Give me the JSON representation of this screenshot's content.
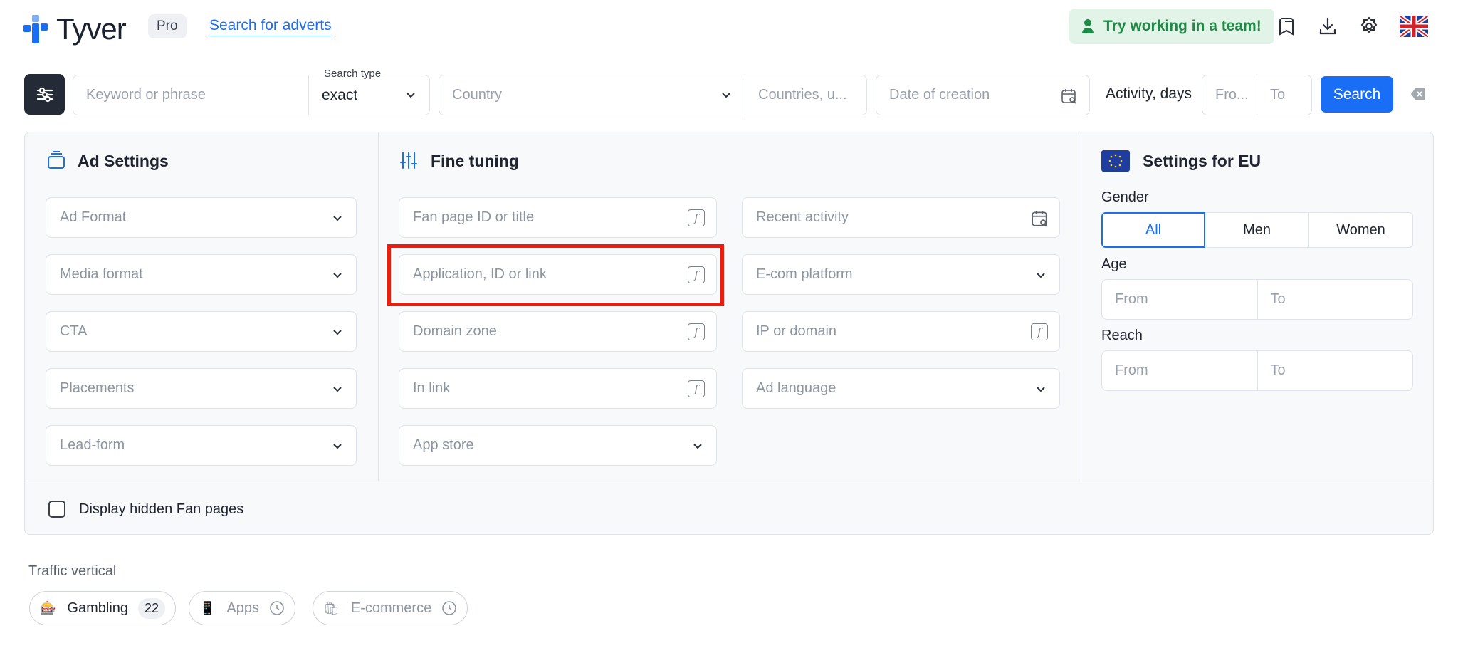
{
  "header": {
    "brand": "Tyver",
    "plan_badge": "Pro",
    "search_link": "Search for adverts",
    "team_button": "Try working in a team!",
    "icons": [
      "bookmarks-icon",
      "download-icon",
      "settings-icon",
      "uk-flag-icon"
    ]
  },
  "search_bar": {
    "keyword_placeholder": "Keyword or phrase",
    "search_type_label": "Search type",
    "search_type_value": "exact",
    "country_placeholder": "Country",
    "countries_placeholder": "Countries, u...",
    "date_placeholder": "Date of creation",
    "activity_label": "Activity, days",
    "activity_from": "Fro...",
    "activity_to": "To",
    "search_button": "Search"
  },
  "ad_settings": {
    "title": "Ad Settings",
    "fields": [
      "Ad Format",
      "Media format",
      "CTA",
      "Placements",
      "Lead-form"
    ]
  },
  "fine_tuning": {
    "title": "Fine tuning",
    "left_fields": [
      "Fan page ID or title",
      "Application, ID or link",
      "Domain zone",
      "In link",
      "App store"
    ],
    "right_fields": [
      "Recent activity",
      "E-com platform",
      "IP or domain",
      "Ad language"
    ]
  },
  "eu_settings": {
    "title": "Settings for EU",
    "gender_label": "Gender",
    "gender_options": [
      "All",
      "Men",
      "Women"
    ],
    "gender_selected": "All",
    "age_label": "Age",
    "reach_label": "Reach",
    "from": "From",
    "to": "To"
  },
  "hidden_pages_label": "Display hidden Fan pages",
  "traffic": {
    "label": "Traffic vertical",
    "chips": [
      {
        "label": "Gambling",
        "count": "22"
      },
      {
        "label": "Apps"
      },
      {
        "label": "E-commerce"
      }
    ]
  },
  "colors": {
    "accent": "#1a6df5",
    "highlight": "#ee1c0d",
    "team_bg": "#e2f3e7",
    "team_text": "#1f8a46"
  }
}
